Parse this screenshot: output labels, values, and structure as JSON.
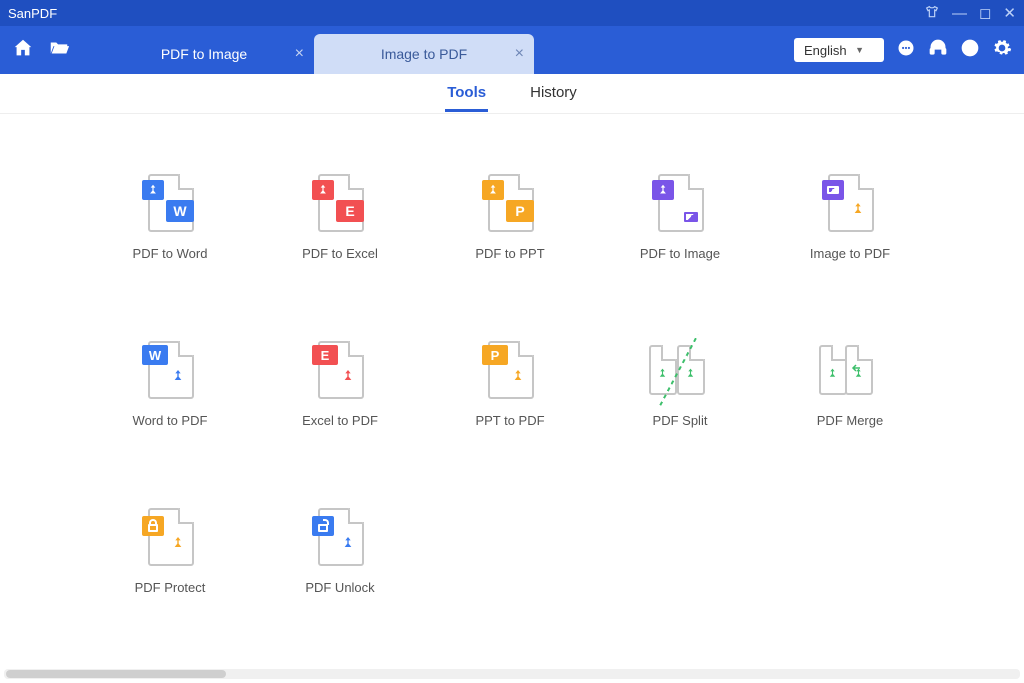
{
  "app": {
    "title": "SanPDF"
  },
  "language": {
    "selected": "English"
  },
  "tabs": [
    {
      "label": "PDF to Image",
      "active": false
    },
    {
      "label": "Image to PDF",
      "active": true
    }
  ],
  "subnav": {
    "tools": "Tools",
    "history": "History",
    "active": "tools"
  },
  "tools": [
    {
      "id": "pdf-to-word",
      "label": "PDF to Word"
    },
    {
      "id": "pdf-to-excel",
      "label": "PDF to Excel"
    },
    {
      "id": "pdf-to-ppt",
      "label": "PDF to PPT"
    },
    {
      "id": "pdf-to-image",
      "label": "PDF to Image"
    },
    {
      "id": "image-to-pdf",
      "label": "Image to PDF"
    },
    {
      "id": "word-to-pdf",
      "label": "Word to PDF"
    },
    {
      "id": "excel-to-pdf",
      "label": "Excel to PDF"
    },
    {
      "id": "ppt-to-pdf",
      "label": "PPT to PDF"
    },
    {
      "id": "pdf-split",
      "label": "PDF Split"
    },
    {
      "id": "pdf-merge",
      "label": "PDF Merge"
    },
    {
      "id": "pdf-protect",
      "label": "PDF Protect"
    },
    {
      "id": "pdf-unlock",
      "label": "PDF Unlock"
    }
  ]
}
